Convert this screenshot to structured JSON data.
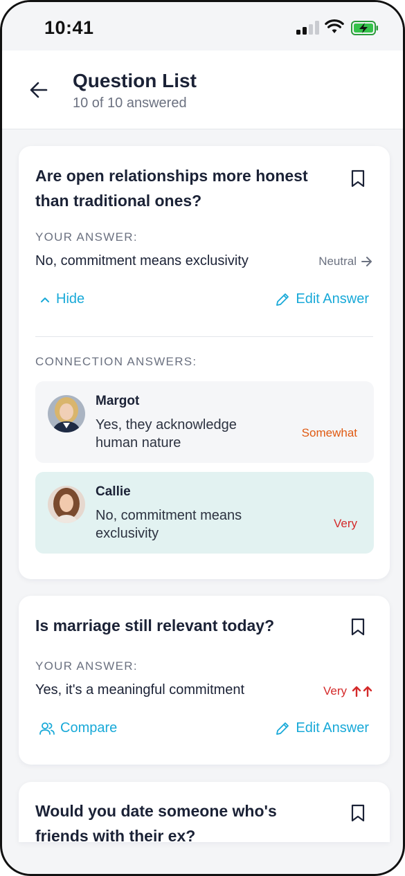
{
  "status_bar": {
    "time": "10:41"
  },
  "header": {
    "title": "Question List",
    "subtitle": "10 of 10 answered"
  },
  "colors": {
    "accent": "#18a9d8",
    "somewhat": "#e05a12",
    "very": "#d42a2a",
    "highlight_bg": "#e2f2f1"
  },
  "questions": [
    {
      "question": "Are open relationships more honest than traditional ones?",
      "your_answer_label": "YOUR ANSWER:",
      "your_answer": "No, commitment means exclusivity",
      "importance": "Neutral",
      "hide_label": "Hide",
      "edit_label": "Edit Answer",
      "connections_label": "CONNECTION ANSWERS:",
      "connections": [
        {
          "name": "Margot",
          "answer": "Yes, they acknowledge human nature",
          "level": "Somewhat"
        },
        {
          "name": "Callie",
          "answer": "No, commitment means exclusivity",
          "level": "Very"
        }
      ]
    },
    {
      "question": "Is marriage still relevant today?",
      "your_answer_label": "YOUR ANSWER:",
      "your_answer": "Yes, it's a meaningful commitment",
      "importance": "Very",
      "compare_label": "Compare",
      "edit_label": "Edit Answer"
    },
    {
      "question": "Would you date someone who's friends with their ex?"
    }
  ]
}
